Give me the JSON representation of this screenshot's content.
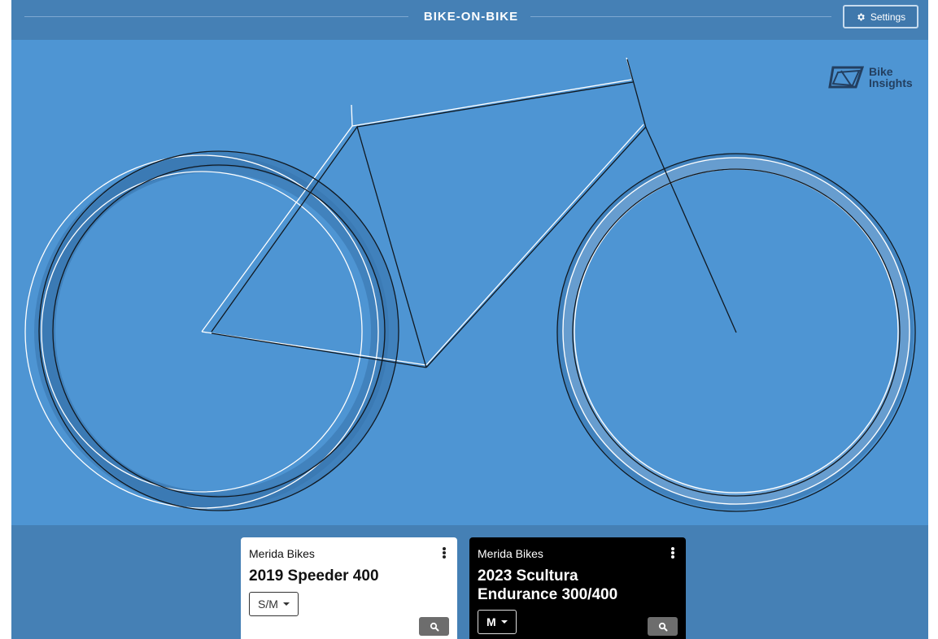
{
  "header": {
    "title": "BIKE-ON-BIKE",
    "settings_label": "Settings",
    "settings_icon": "gear-icon"
  },
  "logo": {
    "line1": "Bike",
    "line2": "Insights"
  },
  "colors": {
    "header_bg": "#4580b5",
    "canvas_bg": "#4e95d3",
    "bike_a_stroke": "#ffffff",
    "bike_b_stroke": "#000000"
  },
  "bikes": [
    {
      "brand": "Merida Bikes",
      "model": "2019 Speeder 400",
      "size": "S/M",
      "theme": "light"
    },
    {
      "brand": "Merida Bikes",
      "model": "2023 Scultura Endurance 300/400",
      "size": "M",
      "theme": "dark"
    }
  ]
}
